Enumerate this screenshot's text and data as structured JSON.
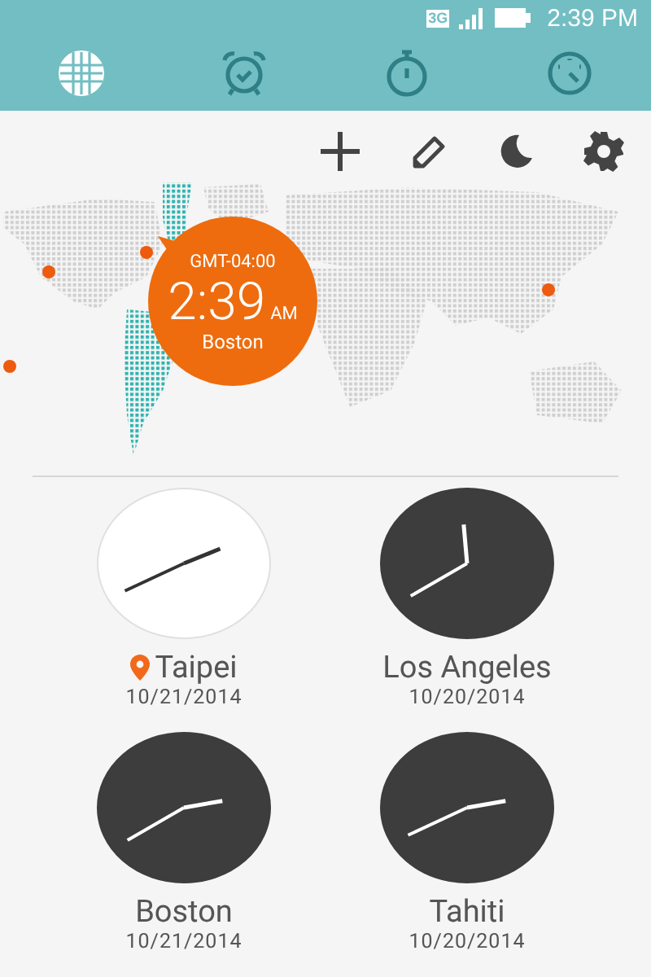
{
  "status_bar": {
    "network": "3G",
    "time": "2:39 PM"
  },
  "tabs": [
    {
      "kind": "world",
      "selected": true
    },
    {
      "kind": "alarm",
      "selected": false
    },
    {
      "kind": "stopwatch",
      "selected": false
    },
    {
      "kind": "timer",
      "selected": false
    }
  ],
  "toolbar": [
    {
      "kind": "add"
    },
    {
      "kind": "edit"
    },
    {
      "kind": "night"
    },
    {
      "kind": "settings"
    }
  ],
  "map": {
    "bubble": {
      "offset": "GMT-04:00",
      "time": "2:39",
      "period": "AM",
      "city": "Boston"
    }
  },
  "clocks": [
    {
      "city": "Taipei",
      "date": "10/21/2014",
      "kind": "day",
      "current": true
    },
    {
      "city": "Los Angeles",
      "date": "10/20/2014",
      "kind": "night",
      "current": false
    },
    {
      "city": "Boston",
      "date": "10/21/2014",
      "kind": "night",
      "current": false
    },
    {
      "city": "Tahiti",
      "date": "10/20/2014",
      "kind": "night",
      "current": false
    }
  ]
}
